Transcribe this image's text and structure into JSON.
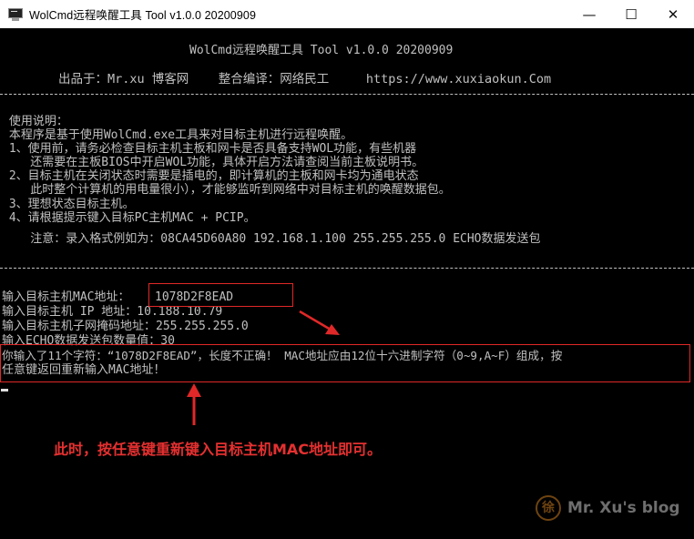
{
  "window": {
    "title": "WolCmd远程唤醒工具 Tool v1.0.0 20200909",
    "minimize_glyph": "—",
    "maximize_glyph": "☐",
    "close_glyph": "✕"
  },
  "header": {
    "title": "WolCmd远程唤醒工具 Tool v1.0.0 20200909",
    "credits": "出品于：Mr.xu 博客网    整合编译：网络民工     https://www.xuxiaokun.Com"
  },
  "instructions": [
    " 使用说明：",
    " 本程序是基于使用WolCmd.exe工具来对目标主机进行远程唤醒。",
    " 1、使用前，请务必检查目标主机主板和网卡是否具备支持WOL功能，有些机器",
    "    还需要在主板BIOS中开启WOL功能，具体开启方法请查阅当前主板说明书。",
    " 2、目标主机在关闭状态时需要是插电的，即计算机的主板和网卡均为通电状态",
    "    此时整个计算机的用电量很小），才能够监听到网络中对目标主机的唤醒数据包。",
    " 3、理想状态目标主机。",
    " 4、请根据提示键入目标PC主机MAC + PCIP。",
    "    注意：录入格式例如为：08CA45D60A80 192.168.1.100 255.255.255.0 ECHO数据发送包"
  ],
  "prompts": {
    "mac_label": "输入目标主机MAC地址：",
    "mac_value": "1078D2F8EAD",
    "ip_line": "输入目标主机 IP 地址：10.188.10.79",
    "mask_line": "输入目标主机子网掩码地址：255.255.255.0",
    "echo_line": "输入ECHO数据发送包数量值：30",
    "error_line1": "你输入了11个字符：“1078D2F8EAD”，长度不正确！ MAC地址应由12位十六进制字符（0~9,A~F）组成，按",
    "error_line2": "任意键返回重新输入MAC地址！"
  },
  "annotation": {
    "note": "此时，按任意键重新键入目标主机MAC地址即可。"
  },
  "watermark": {
    "logo": "徐",
    "text": "Mr. Xu's blog"
  },
  "colors": {
    "console_bg": "#000000",
    "console_text": "#c0c0c0",
    "annotation_red": "#e02828"
  }
}
